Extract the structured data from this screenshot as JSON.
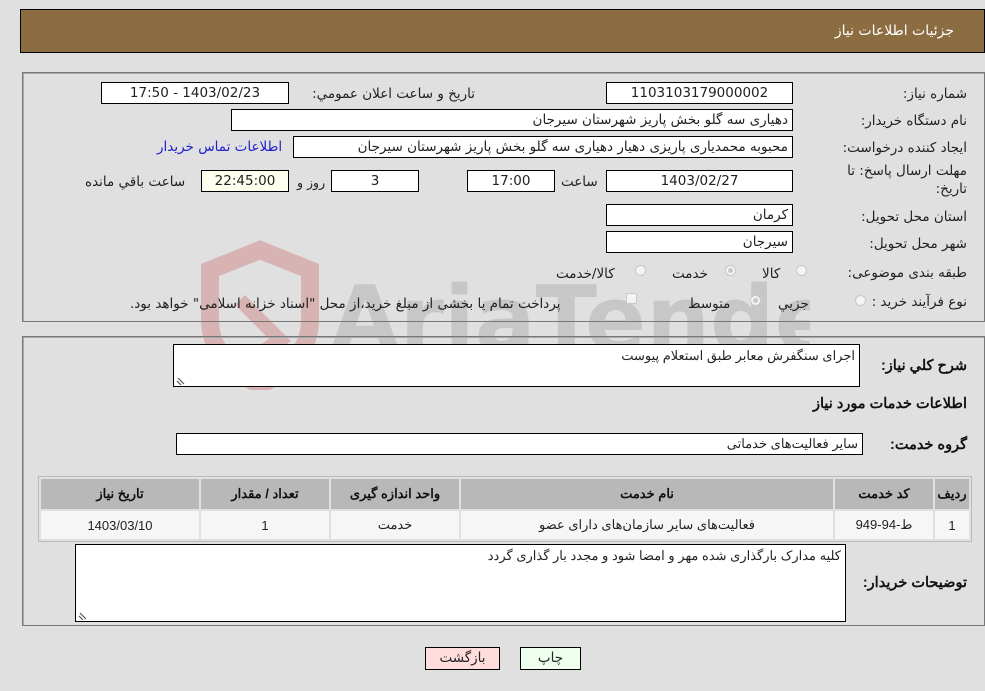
{
  "header": {
    "title": "جزئیات اطلاعات نیاز"
  },
  "form": {
    "need_number": {
      "label": "شماره نیاز:",
      "value": "1103103179000002"
    },
    "announce_datetime": {
      "label": "تاریخ و ساعت اعلان عمومي:",
      "value": "1403/02/23 - 17:50"
    },
    "buyer_org": {
      "label": "نام دستگاه خریدار:",
      "value": "دهیاری سه گلو بخش پاریز شهرستان سیرجان"
    },
    "creator": {
      "label": "ایجاد کننده درخواست:",
      "value": "محبوبه محمدیاری پاریزی دهیار دهیاری سه گلو بخش پاریز شهرستان سیرجان"
    },
    "contact_link": "اطلاعات تماس خریدار",
    "deadline": {
      "label_line1": "مهلت ارسال پاسخ: تا",
      "label_line2": "تاریخ:",
      "date": "1403/02/27",
      "time_label": "ساعت",
      "time": "17:00",
      "days": "3",
      "days_label": "روز و",
      "remaining": "22:45:00",
      "remaining_label": "ساعت باقي مانده"
    },
    "province": {
      "label": "استان محل تحویل:",
      "value": "کرمان"
    },
    "city": {
      "label": "شهر محل تحویل:",
      "value": "سیرجان"
    },
    "category": {
      "label": "طبقه بندی موضوعی:",
      "options": [
        "کالا",
        "خدمت",
        "کالا/خدمت"
      ],
      "selected": "خدمت"
    },
    "purchase_type": {
      "label": "نوع فرآیند خرید :",
      "options": [
        "جزيي",
        "متوسط"
      ],
      "selected": "متوسط",
      "treasury_note": "پرداخت تمام یا بخشی از مبلغ خرید،از محل \"اسناد خزانه اسلامی\" خواهد بود."
    }
  },
  "details": {
    "general_desc_label": "شرح كلي نياز:",
    "general_desc": "اجرای سنگفرش معابر طبق استعلام پیوست",
    "services_title": "اطلاعات خدمات مورد نياز",
    "service_group_label": "گروه خدمت:",
    "service_group": "سایر فعالیت‌های خدماتی",
    "table": {
      "headers": [
        "ردیف",
        "کد خدمت",
        "نام خدمت",
        "واحد اندازه گیری",
        "تعداد / مقدار",
        "تاریخ نیاز"
      ],
      "rows": [
        [
          "1",
          "ط-94-949",
          "فعالیت‌های سایر سازمان‌های دارای عضو",
          "خدمت",
          "1",
          "1403/03/10"
        ]
      ]
    },
    "buyer_notes_label": "توضیحات خریدار:",
    "buyer_notes": "کلیه مدارک بارگذاری شده مهر و امضا شود و مجدد بار گذاری گردد"
  },
  "buttons": {
    "print": "چاپ",
    "back": "بازگشت"
  },
  "colors": {
    "header_bg": "#8c6d42",
    "print_bg": "#eeffee",
    "back_bg": "#ffdddd",
    "link": "#2020cc"
  }
}
